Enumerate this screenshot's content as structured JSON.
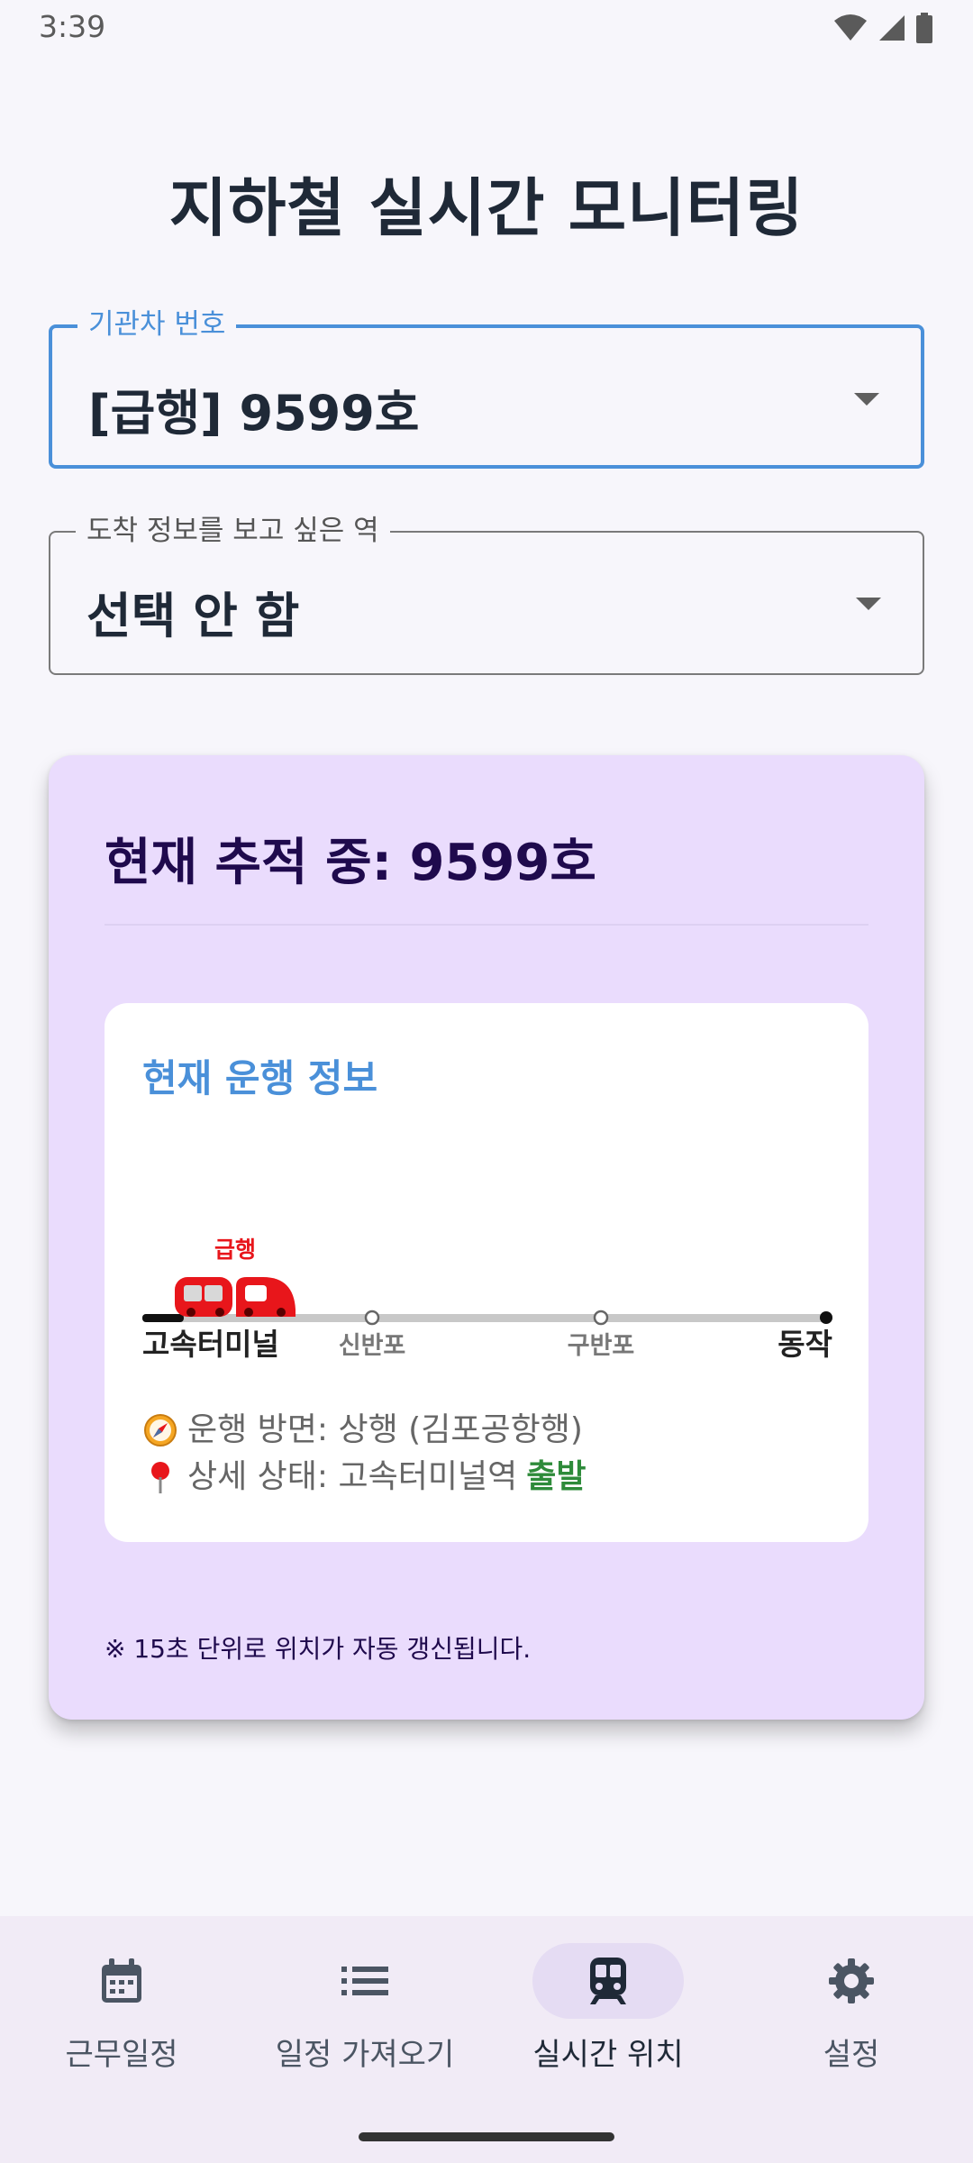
{
  "status_bar": {
    "time": "3:39"
  },
  "page_title": "지하철 실시간 모니터링",
  "train_field": {
    "label": "기관차 번호",
    "value": "[급행] 9599호"
  },
  "station_field": {
    "label": "도착 정보를 보고 싶은 역",
    "value": "선택 안 함"
  },
  "tracking": {
    "title": "현재 추적 중: 9599호",
    "info_title": "현재 운행 정보",
    "train_type_badge": "급행",
    "stations": [
      "고속터미널",
      "신반포",
      "구반포",
      "동작"
    ],
    "progress_fraction": 0.06,
    "direction_label": "운행 방면: 상행 (김포공항행)",
    "detail_prefix": "상세 상태: 고속터미널역",
    "detail_status": "출발",
    "footnote": "※ 15초 단위로 위치가 자동 갱신됩니다."
  },
  "nav": {
    "items": [
      {
        "label": "근무일정",
        "icon": "calendar-icon"
      },
      {
        "label": "일정 가져오기",
        "icon": "list-icon"
      },
      {
        "label": "실시간 위치",
        "icon": "train-icon",
        "active": true
      },
      {
        "label": "설정",
        "icon": "gear-icon"
      }
    ]
  },
  "colors": {
    "accent": "#4a90d9",
    "card_bg": "#eadcfd",
    "train_red": "#e8161b",
    "departed_green": "#2e8b3a"
  }
}
